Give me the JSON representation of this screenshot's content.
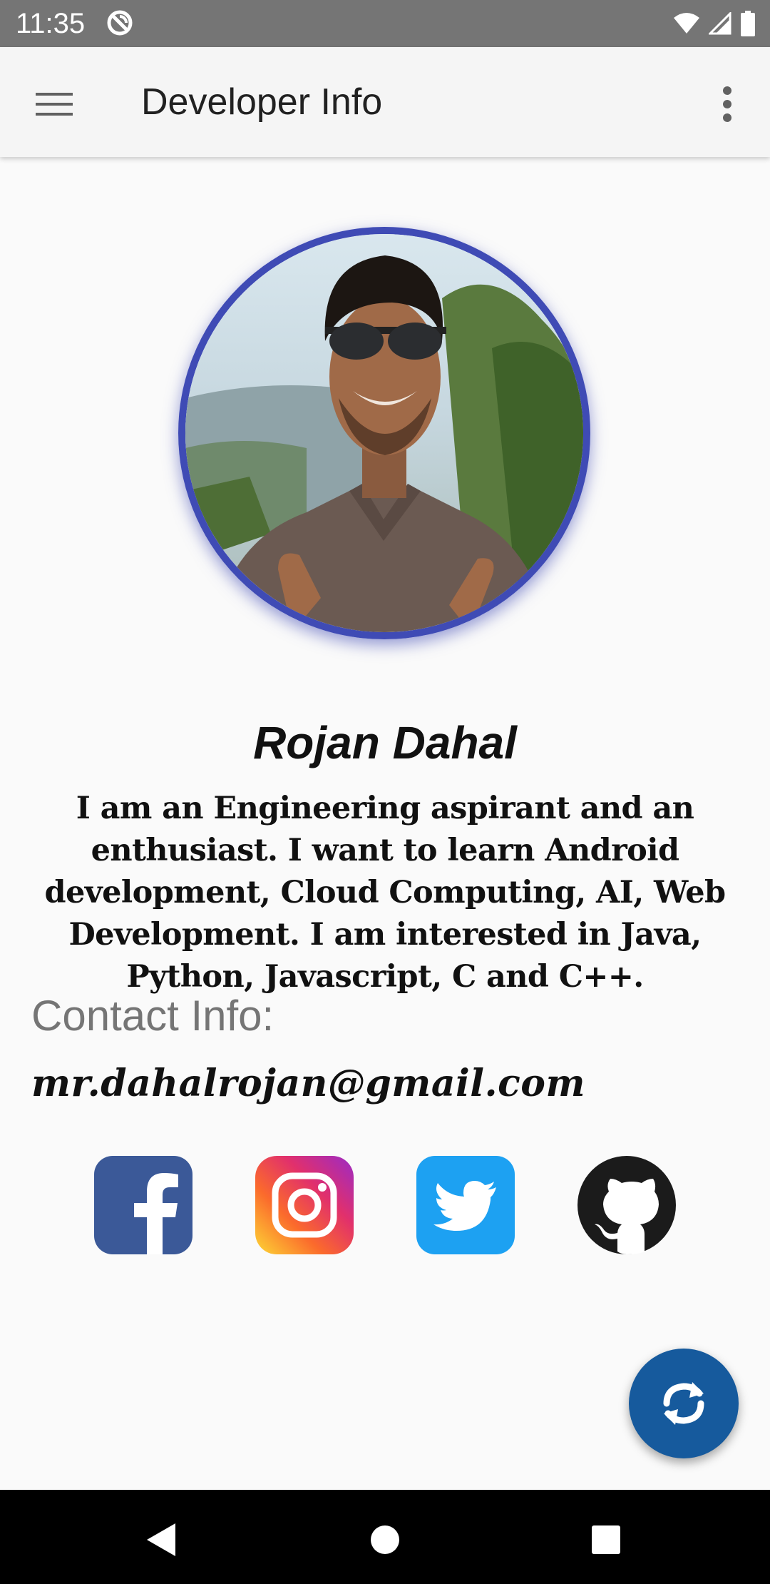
{
  "status_bar": {
    "time": "11:35",
    "icons": [
      "app-notification-icon",
      "wifi-icon",
      "signal-icon",
      "battery-icon"
    ]
  },
  "app_bar": {
    "title": "Developer Info",
    "menu_icon": "hamburger-menu-icon",
    "overflow_icon": "more-vert-icon"
  },
  "profile": {
    "name": "Rojan Dahal",
    "bio": "I am an Engineering aspirant and an enthusiast. I want to learn Android development, Cloud Computing, AI, Web Development. I am interested in Java, Python, Javascript, C and C++.",
    "avatar_border_color": "#3f4bb5"
  },
  "contact": {
    "heading": "Contact Info:",
    "email": "mr.dahalrojan@gmail.com"
  },
  "social": [
    {
      "name": "facebook",
      "icon": "facebook-icon",
      "color": "#3b5998"
    },
    {
      "name": "instagram",
      "icon": "instagram-icon",
      "color": "#e1306c"
    },
    {
      "name": "twitter",
      "icon": "twitter-icon",
      "color": "#1da1f2"
    },
    {
      "name": "github",
      "icon": "github-icon",
      "color": "#1b1b1b"
    }
  ],
  "fab": {
    "icon": "refresh-icon",
    "color": "#165a9d"
  },
  "nav_bar": {
    "buttons": [
      "back-icon",
      "home-icon",
      "recents-icon"
    ]
  }
}
